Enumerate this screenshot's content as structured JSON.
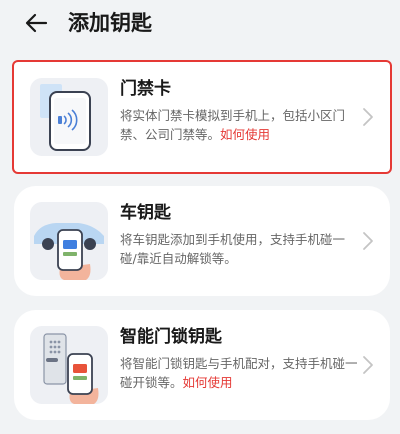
{
  "header": {
    "title": "添加钥匙"
  },
  "cards": [
    {
      "title": "门禁卡",
      "desc": "将实体门禁卡模拟到手机上，包括小区门禁、公司门禁等。",
      "link": "如何使用"
    },
    {
      "title": "车钥匙",
      "desc": "将车钥匙添加到手机使用，支持手机碰一碰/靠近自动解锁等。",
      "link": ""
    },
    {
      "title": "智能门锁钥匙",
      "desc": "将智能门锁钥匙与手机配对，支持手机碰一碰开锁等。",
      "link": "如何使用"
    }
  ],
  "colors": {
    "accent": "#e53935",
    "card_bg": "#ffffff",
    "page_bg": "#f1f3f5"
  }
}
